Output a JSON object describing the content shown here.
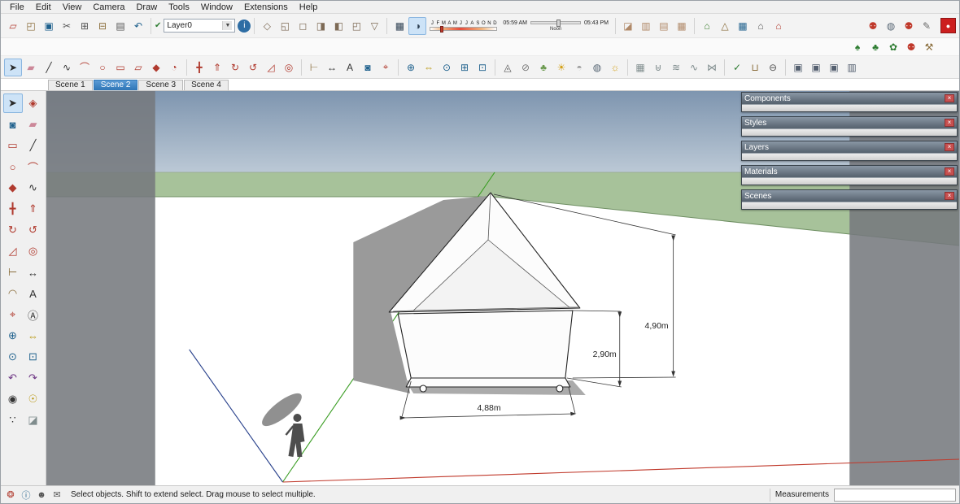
{
  "menu": {
    "items": [
      "File",
      "Edit",
      "View",
      "Camera",
      "Draw",
      "Tools",
      "Window",
      "Extensions",
      "Help"
    ]
  },
  "ui": {
    "close_glyph": "×",
    "dropdown_arrow": "▼",
    "check_glyph": "✔",
    "record_glyph": "●"
  },
  "toolbar_top": {
    "current_layer": "Layer0",
    "standard_icons": [
      {
        "name": "new-file-icon",
        "glyph": "▱",
        "color": "#b03a2e"
      },
      {
        "name": "open-file-icon",
        "glyph": "◰",
        "color": "#8a6d3b"
      },
      {
        "name": "save-icon",
        "glyph": "▣",
        "color": "#1f618d"
      },
      {
        "name": "cut-icon",
        "glyph": "✂",
        "color": "#555555"
      },
      {
        "name": "copy-icon",
        "glyph": "⊞",
        "color": "#555555"
      },
      {
        "name": "paste-icon",
        "glyph": "⊟",
        "color": "#8a6d3b"
      },
      {
        "name": "print-icon",
        "glyph": "▤",
        "color": "#555555"
      },
      {
        "name": "undo-icon",
        "glyph": "↶",
        "color": "#1f618d"
      }
    ],
    "info_icon": {
      "name": "layer-info-icon",
      "glyph": "i",
      "color": "#ffffff"
    },
    "view_icons": [
      {
        "name": "iso-view-icon",
        "glyph": "◇",
        "color": "#7d6a55"
      },
      {
        "name": "top-view-icon",
        "glyph": "◱",
        "color": "#7d6a55"
      },
      {
        "name": "front-view-icon",
        "glyph": "◻",
        "color": "#7d6a55"
      },
      {
        "name": "right-view-icon",
        "glyph": "◨",
        "color": "#7d6a55"
      },
      {
        "name": "left-view-icon",
        "glyph": "◧",
        "color": "#7d6a55"
      },
      {
        "name": "back-view-icon",
        "glyph": "◰",
        "color": "#7d6a55"
      },
      {
        "name": "bottom-view-icon",
        "glyph": "▽",
        "color": "#7d6a55"
      }
    ],
    "shadow_icons": [
      {
        "name": "shadow-settings-icon",
        "glyph": "▦",
        "color": "#2c3e50"
      },
      {
        "name": "toggle-shadows-icon",
        "glyph": "◑",
        "color": "#2c3e50",
        "active": true
      }
    ],
    "shadows": {
      "months": [
        "J",
        "F",
        "M",
        "A",
        "M",
        "J",
        "J",
        "A",
        "S",
        "O",
        "N",
        "D"
      ],
      "time_start": "05:59 AM",
      "noon_label": "Noon",
      "time_end": "05:43 PM"
    },
    "section_icons": [
      {
        "name": "section-plane-icon",
        "glyph": "◪",
        "color": "#b08968"
      },
      {
        "name": "display-section-planes-icon",
        "glyph": "▥",
        "color": "#b08968"
      },
      {
        "name": "display-section-cuts-icon",
        "glyph": "▤",
        "color": "#b08968"
      },
      {
        "name": "display-section-fill-icon",
        "glyph": "▦",
        "color": "#b08968"
      }
    ],
    "location_icons": [
      {
        "name": "add-location-icon",
        "glyph": "⌂",
        "color": "#3a7d2c"
      },
      {
        "name": "toggle-terrain-icon",
        "glyph": "△",
        "color": "#8a6d3b"
      },
      {
        "name": "photo-texture-icon",
        "glyph": "▦",
        "color": "#1f618d"
      },
      {
        "name": "building-icon",
        "glyph": "⌂",
        "color": "#555555"
      },
      {
        "name": "warehouse-icon",
        "glyph": "⌂",
        "color": "#b03a2e"
      }
    ],
    "right_icons": [
      {
        "name": "people-icon",
        "glyph": "⚉",
        "color": "#c0392b"
      },
      {
        "name": "globe-icon",
        "glyph": "◍",
        "color": "#566573"
      },
      {
        "name": "people-icon",
        "glyph": "⚉",
        "color": "#c0392b"
      },
      {
        "name": "pencil-ruler-icon",
        "glyph": "✎",
        "color": "#6b6b6b"
      }
    ]
  },
  "toolbar_plants": [
    {
      "name": "tree-icon",
      "glyph": "♠",
      "color": "#2e7d32"
    },
    {
      "name": "shrub-icon",
      "glyph": "♣",
      "color": "#2e7d32"
    },
    {
      "name": "flower-icon",
      "glyph": "✿",
      "color": "#2e7d32"
    },
    {
      "name": "people-icon",
      "glyph": "⚉",
      "color": "#c0392b"
    },
    {
      "name": "toolbox-icon",
      "glyph": "⚒",
      "color": "#8a6d3b"
    }
  ],
  "toolbar_main": {
    "g1": [
      {
        "name": "select-tool-icon",
        "glyph": "➤",
        "color": "#2b2b2b",
        "active": true
      },
      {
        "name": "eraser-tool-icon",
        "glyph": "▰",
        "color": "#cc8899"
      },
      {
        "name": "line-tool-icon",
        "glyph": "╱",
        "color": "#333333"
      },
      {
        "name": "freehand-tool-icon",
        "glyph": "∿",
        "color": "#333333"
      },
      {
        "name": "arc-tool-icon",
        "glyph": "⌒",
        "color": "#b03a2e"
      },
      {
        "name": "circle-tool-icon",
        "glyph": "○",
        "color": "#b03a2e"
      },
      {
        "name": "rectangle-tool-icon",
        "glyph": "▭",
        "color": "#b03a2e"
      },
      {
        "name": "rotated-rectangle-tool-icon",
        "glyph": "▱",
        "color": "#b03a2e"
      },
      {
        "name": "polygon-tool-icon",
        "glyph": "◆",
        "color": "#b03a2e"
      },
      {
        "name": "pie-tool-icon",
        "glyph": "◔",
        "color": "#b03a2e"
      }
    ],
    "g2": [
      {
        "name": "move-tool-icon",
        "glyph": "╋",
        "color": "#b03a2e"
      },
      {
        "name": "push-pull-tool-icon",
        "glyph": "⇑",
        "color": "#b03a2e"
      },
      {
        "name": "rotate-tool-icon",
        "glyph": "↻",
        "color": "#b03a2e"
      },
      {
        "name": "follow-me-tool-icon",
        "glyph": "↺",
        "color": "#b03a2e"
      },
      {
        "name": "scale-tool-icon",
        "glyph": "◿",
        "color": "#b03a2e"
      },
      {
        "name": "offset-tool-icon",
        "glyph": "◎",
        "color": "#b03a2e"
      }
    ],
    "g3": [
      {
        "name": "tape-measure-icon",
        "glyph": "⊢",
        "color": "#8a6d3b"
      },
      {
        "name": "dimension-tool-icon",
        "glyph": "↔",
        "color": "#333333"
      },
      {
        "name": "text-tool-icon",
        "glyph": "A",
        "color": "#333333"
      },
      {
        "name": "paint-bucket-icon",
        "glyph": "◙",
        "color": "#1f618d"
      },
      {
        "name": "axes-tool-icon",
        "glyph": "⌖",
        "color": "#b03a2e"
      }
    ],
    "g4": [
      {
        "name": "orbit-tool-icon",
        "glyph": "⊕",
        "color": "#1f618d"
      },
      {
        "name": "pan-tool-icon",
        "glyph": "⇔",
        "color": "#b7950b"
      },
      {
        "name": "zoom-tool-icon",
        "glyph": "⊙",
        "color": "#1f618d"
      },
      {
        "name": "zoom-window-icon",
        "glyph": "⊞",
        "color": "#1f618d"
      },
      {
        "name": "zoom-extents-icon",
        "glyph": "⊡",
        "color": "#1f618d"
      }
    ],
    "g5": [
      {
        "name": "graduation-cap-icon",
        "glyph": "◬",
        "color": "#555555"
      },
      {
        "name": "circle-slash-icon",
        "glyph": "⊘",
        "color": "#777777"
      },
      {
        "name": "leaf-icon",
        "glyph": "♣",
        "color": "#6a994e"
      },
      {
        "name": "sun-icon",
        "glyph": "☀",
        "color": "#d4a017"
      },
      {
        "name": "dome-icon",
        "glyph": "◓",
        "color": "#999999"
      },
      {
        "name": "globe-icon",
        "glyph": "◍",
        "color": "#566573"
      },
      {
        "name": "sun-gear-icon",
        "glyph": "☼",
        "color": "#d4a017"
      }
    ],
    "g6": [
      {
        "name": "mesh-icon",
        "glyph": "▦",
        "color": "#7f8c8d"
      },
      {
        "name": "stamp-icon",
        "glyph": "⊎",
        "color": "#7f8c8d"
      },
      {
        "name": "drape-icon",
        "glyph": "≋",
        "color": "#7f8c8d"
      },
      {
        "name": "smoove-icon",
        "glyph": "∿",
        "color": "#7f8c8d"
      },
      {
        "name": "flip-edge-icon",
        "glyph": "⋈",
        "color": "#7f8c8d"
      }
    ],
    "g7": [
      {
        "name": "check-circle-icon",
        "glyph": "✓",
        "color": "#2e7d32"
      },
      {
        "name": "mug-icon",
        "glyph": "⊔",
        "color": "#8a6d3b"
      },
      {
        "name": "cylinder-icon",
        "glyph": "⊖",
        "color": "#555555"
      }
    ],
    "g8": [
      {
        "name": "dialog-window-icon",
        "glyph": "▣",
        "color": "#556070"
      },
      {
        "name": "dialog-window-icon",
        "glyph": "▣",
        "color": "#556070"
      },
      {
        "name": "dialog-window-icon",
        "glyph": "▣",
        "color": "#556070"
      },
      {
        "name": "dialog-window-icon",
        "glyph": "▥",
        "color": "#556070"
      }
    ]
  },
  "scene_tabs": [
    {
      "label": "Scene 1"
    },
    {
      "label": "Scene 2",
      "active": true
    },
    {
      "label": "Scene 3"
    },
    {
      "label": "Scene 4"
    }
  ],
  "tool_palette": [
    {
      "name": "select-tool-icon",
      "glyph": "➤",
      "color": "#2b2b2b",
      "active": true
    },
    {
      "name": "make-component-icon",
      "glyph": "◈",
      "color": "#b03a2e"
    },
    {
      "name": "paint-bucket-icon",
      "glyph": "◙",
      "color": "#1f618d"
    },
    {
      "name": "eraser-tool-icon",
      "glyph": "▰",
      "color": "#cc8899"
    },
    {
      "name": "rectangle-tool-icon",
      "glyph": "▭",
      "color": "#b03a2e"
    },
    {
      "name": "line-tool-icon",
      "glyph": "╱",
      "color": "#333333"
    },
    {
      "name": "circle-tool-icon",
      "glyph": "○",
      "color": "#b03a2e"
    },
    {
      "name": "arc-tool-icon",
      "glyph": "⌒",
      "color": "#b03a2e"
    },
    {
      "name": "polygon-tool-icon",
      "glyph": "◆",
      "color": "#b03a2e"
    },
    {
      "name": "freehand-tool-icon",
      "glyph": "∿",
      "color": "#333333"
    },
    {
      "name": "move-tool-icon",
      "glyph": "╋",
      "color": "#b03a2e"
    },
    {
      "name": "push-pull-tool-icon",
      "glyph": "⇑",
      "color": "#b03a2e"
    },
    {
      "name": "rotate-tool-icon",
      "glyph": "↻",
      "color": "#b03a2e"
    },
    {
      "name": "follow-me-tool-icon",
      "glyph": "↺",
      "color": "#b03a2e"
    },
    {
      "name": "scale-tool-icon",
      "glyph": "◿",
      "color": "#b03a2e"
    },
    {
      "name": "offset-tool-icon",
      "glyph": "◎",
      "color": "#b03a2e"
    },
    {
      "name": "tape-measure-icon",
      "glyph": "⊢",
      "color": "#8a6d3b"
    },
    {
      "name": "dimension-tool-icon",
      "glyph": "↔",
      "color": "#333333"
    },
    {
      "name": "protractor-tool-icon",
      "glyph": "◠",
      "color": "#8a6d3b"
    },
    {
      "name": "text-tool-icon",
      "glyph": "A",
      "color": "#333333"
    },
    {
      "name": "axes-tool-icon",
      "glyph": "⌖",
      "color": "#b03a2e"
    },
    {
      "name": "3d-text-tool-icon",
      "glyph": "Ⓐ",
      "color": "#333333"
    },
    {
      "name": "orbit-tool-icon",
      "glyph": "⊕",
      "color": "#1f618d"
    },
    {
      "name": "pan-tool-icon",
      "glyph": "⇔",
      "color": "#b7950b"
    },
    {
      "name": "zoom-tool-icon",
      "glyph": "⊙",
      "color": "#1f618d"
    },
    {
      "name": "zoom-extents-icon",
      "glyph": "⊡",
      "color": "#1f618d"
    },
    {
      "name": "previous-view-icon",
      "glyph": "↶",
      "color": "#6c3483"
    },
    {
      "name": "next-view-icon",
      "glyph": "↷",
      "color": "#6c3483"
    },
    {
      "name": "position-camera-icon",
      "glyph": "◉",
      "color": "#333333"
    },
    {
      "name": "look-around-icon",
      "glyph": "☉",
      "color": "#b7950b"
    },
    {
      "name": "walk-tool-icon",
      "glyph": "∵",
      "color": "#333333"
    },
    {
      "name": "section-plane-icon",
      "glyph": "◪",
      "color": "#7f8c8d"
    }
  ],
  "panels": [
    {
      "title": "Components"
    },
    {
      "title": "Styles"
    },
    {
      "title": "Layers"
    },
    {
      "title": "Materials"
    },
    {
      "title": "Scenes"
    }
  ],
  "statusbar": {
    "icons": [
      {
        "name": "medal-icon",
        "glyph": "❂",
        "color": "#b03a2e"
      },
      {
        "name": "info-icon",
        "glyph": "ⓘ",
        "color": "#1f618d"
      },
      {
        "name": "person-icon",
        "glyph": "☻",
        "color": "#555555"
      },
      {
        "name": "mail-icon",
        "glyph": "✉",
        "color": "#555555"
      }
    ],
    "hint": "Select objects. Shift to extend select. Drag mouse to select multiple.",
    "measurements_label": "Measurements",
    "measurements_value": ""
  },
  "viewport": {
    "dimensions": {
      "height_total": "4,90m",
      "height_wall": "2,90m",
      "width": "4,88m"
    },
    "axis_colors": {
      "red": "#c0392b",
      "green": "#3a9d23",
      "blue": "#27408b"
    },
    "sky_top": "#7e95af",
    "sky_bottom": "#cfd9e2",
    "ground_green": "#a7c29a"
  }
}
